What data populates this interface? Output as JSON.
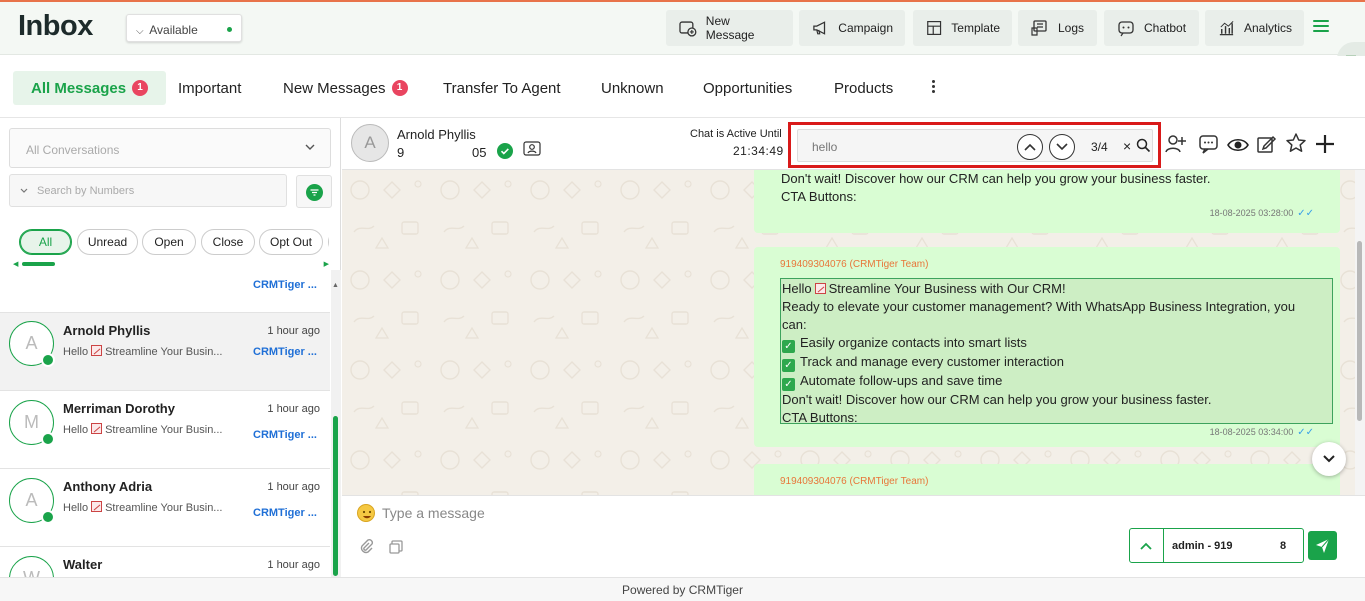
{
  "header": {
    "title": "Inbox",
    "status": "Available",
    "buttons": {
      "new_message": "New Message",
      "campaign": "Campaign",
      "template": "Template",
      "logs": "Logs",
      "chatbot": "Chatbot",
      "analytics": "Analytics"
    }
  },
  "tabs": {
    "all_messages": "All Messages",
    "all_messages_badge": "1",
    "important": "Important",
    "new_messages": "New Messages",
    "new_messages_badge": "1",
    "transfer": "Transfer To Agent",
    "unknown": "Unknown",
    "opportunities": "Opportunities",
    "products": "Products"
  },
  "sidebar": {
    "conversations_placeholder": "All Conversations",
    "search_placeholder": "Search by Numbers",
    "chips": {
      "all": "All",
      "unread": "Unread",
      "open": "Open",
      "close": "Close",
      "opt_out": "Opt Out"
    },
    "partial_owner": "CRMTiger ...",
    "conversations": [
      {
        "initial": "A",
        "name": "Arnold Phyllis",
        "time": "1 hour ago",
        "preview_pre": "Hello",
        "preview_post": "Streamline Your Busin...",
        "owner": "CRMTiger ..."
      },
      {
        "initial": "M",
        "name": "Merriman Dorothy",
        "time": "1 hour ago",
        "preview_pre": "Hello",
        "preview_post": "Streamline Your Busin...",
        "owner": "CRMTiger ..."
      },
      {
        "initial": "A",
        "name": "Anthony Adria",
        "time": "1 hour ago",
        "preview_pre": "Hello",
        "preview_post": "Streamline Your Busin...",
        "owner": "CRMTiger ..."
      },
      {
        "initial": "W",
        "name": "Walter",
        "time": "1 hour ago"
      }
    ]
  },
  "chat": {
    "contact_initial": "A",
    "contact_name": "Arnold Phyllis",
    "phone_start": "9",
    "phone_end": "05",
    "active_label": "Chat is Active Until",
    "active_time": "21:34:49",
    "search": {
      "query": "hello",
      "count": "3/4",
      "clear": "×"
    },
    "messages": [
      {
        "lines": [
          "Don't wait! Discover how our CRM can help you grow your business faster.",
          "CTA Buttons:"
        ],
        "timestamp": "18-08-2025 03:28:00"
      },
      {
        "sender": "919409304076 (CRMTiger Team)",
        "line1_pre": "Hello",
        "line1_post": "Streamline Your Business with Our CRM!",
        "line2": "Ready to elevate your customer management? With WhatsApp Business Integration, you",
        "line3": "can:",
        "bullets": [
          "Easily organize contacts into smart lists",
          "Track and manage every customer interaction",
          "Automate follow-ups and save time"
        ],
        "line4": "Don't wait! Discover how our CRM can help you grow your business faster.",
        "line5": "CTA Buttons:",
        "timestamp": "18-08-2025 03:34:00"
      },
      {
        "sender": "919409304076 (CRMTiger Team)"
      }
    ],
    "composer_placeholder": "Type a message",
    "agent_label": "admin - 919",
    "agent_suffix": "8"
  },
  "footer": "Powered by CRMTiger",
  "colors": {
    "accent": "#1aa34a",
    "badge": "#e94560",
    "highlight_border": "#d91a1a",
    "bubble": "#d9fdd3"
  }
}
